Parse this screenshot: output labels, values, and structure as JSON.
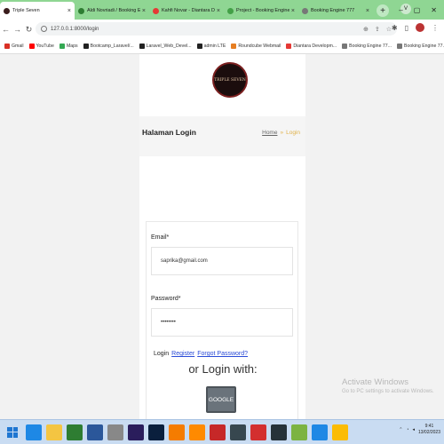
{
  "tabs": [
    {
      "label": "Triple Seven",
      "active": true,
      "color": "#3a1c1c"
    },
    {
      "label": "Aldi Novriadi / Booking Engine",
      "active": false,
      "color": "#2e7d32"
    },
    {
      "label": "Kahfi Novar - Diantara Develo...",
      "active": false,
      "color": "#e53935"
    },
    {
      "label": "Project - Booking Engine 777",
      "active": false,
      "color": "#43a047"
    },
    {
      "label": "Booking Engine 777",
      "active": false,
      "color": "#777777"
    }
  ],
  "profile_initial": "V",
  "url": "127.0.0.1:8000/login",
  "bookmarks": [
    {
      "label": "Gmail",
      "color": "#d93025"
    },
    {
      "label": "YouTube",
      "color": "#ff0000"
    },
    {
      "label": "Maps",
      "color": "#34a853"
    },
    {
      "label": "Bootcamp_Laravel/...",
      "color": "#222222"
    },
    {
      "label": "Laravel_Web_Devel...",
      "color": "#222222"
    },
    {
      "label": "admin LTE",
      "color": "#222222"
    },
    {
      "label": "Roundcube Webmail",
      "color": "#e67e22"
    },
    {
      "label": "Diantara Developm...",
      "color": "#e53935"
    },
    {
      "label": "Booking Engine 77...",
      "color": "#777777"
    },
    {
      "label": "Booking Engine 77...",
      "color": "#777777"
    }
  ],
  "logo_text": "TRIPLE SEVEN",
  "page_title": "Halaman Login",
  "breadcrumb": {
    "home": "Home",
    "separator": "»",
    "current": "Login"
  },
  "form": {
    "email_label": "Email*",
    "email_value": "saprika@gmail.com",
    "password_label": "Password*",
    "password_value": "••••••••",
    "login_label": "Login",
    "register_link": "Register",
    "forgot_link": "Forgot Password?",
    "or_login_with": "or Login with:",
    "google_button": "GOOGLE"
  },
  "activate_windows": {
    "title": "Activate Windows",
    "subtitle": "Go to PC settings to activate Windows."
  },
  "taskbar": {
    "icons": [
      {
        "name": "ie",
        "color": "#1e88e5"
      },
      {
        "name": "file-explorer",
        "color": "#f4c542"
      },
      {
        "name": "store",
        "color": "#2e7d32"
      },
      {
        "name": "word",
        "color": "#2b579a"
      },
      {
        "name": "app",
        "color": "#888888"
      },
      {
        "name": "premiere",
        "color": "#2a1d5c"
      },
      {
        "name": "photoshop",
        "color": "#0a1f3d"
      },
      {
        "name": "xampp",
        "color": "#f57c00"
      },
      {
        "name": "sublime",
        "color": "#ff8a00"
      },
      {
        "name": "app-red",
        "color": "#c62828"
      },
      {
        "name": "c-app",
        "color": "#37474f"
      },
      {
        "name": "acrobat",
        "color": "#d32f2f"
      },
      {
        "name": "app-dark",
        "color": "#263238"
      },
      {
        "name": "app-green",
        "color": "#7cb342"
      },
      {
        "name": "vscode",
        "color": "#1e88e5"
      },
      {
        "name": "chrome",
        "color": "#fbbc05"
      }
    ],
    "time": "9:41",
    "date": "13/02/2023"
  }
}
